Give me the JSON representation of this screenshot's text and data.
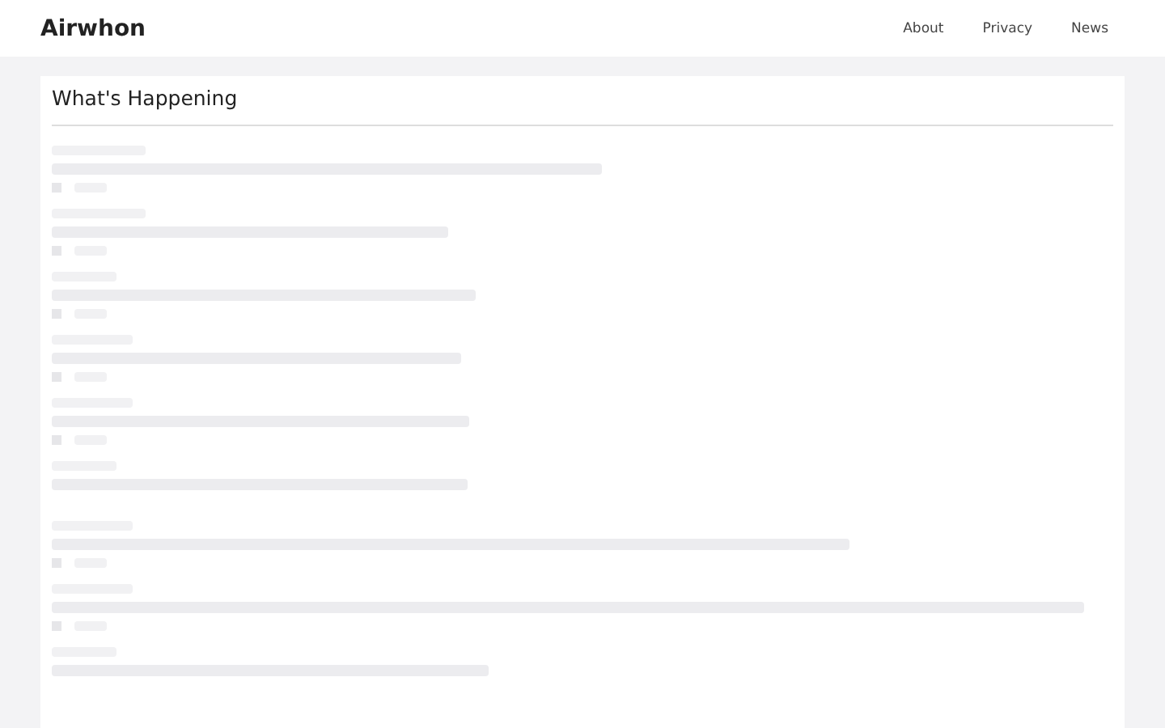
{
  "header": {
    "brand": "Airwhon",
    "nav": [
      {
        "label": "About"
      },
      {
        "label": "Privacy"
      },
      {
        "label": "News"
      }
    ]
  },
  "panel": {
    "title": "What's Happening",
    "items": [
      {
        "kind": "meta"
      },
      {
        "kind": "meta"
      },
      {
        "kind": "meta"
      },
      {
        "kind": "meta"
      },
      {
        "kind": "meta"
      },
      {
        "kind": "plain"
      },
      {
        "kind": "meta"
      },
      {
        "kind": "meta"
      },
      {
        "kind": "plain"
      }
    ]
  }
}
